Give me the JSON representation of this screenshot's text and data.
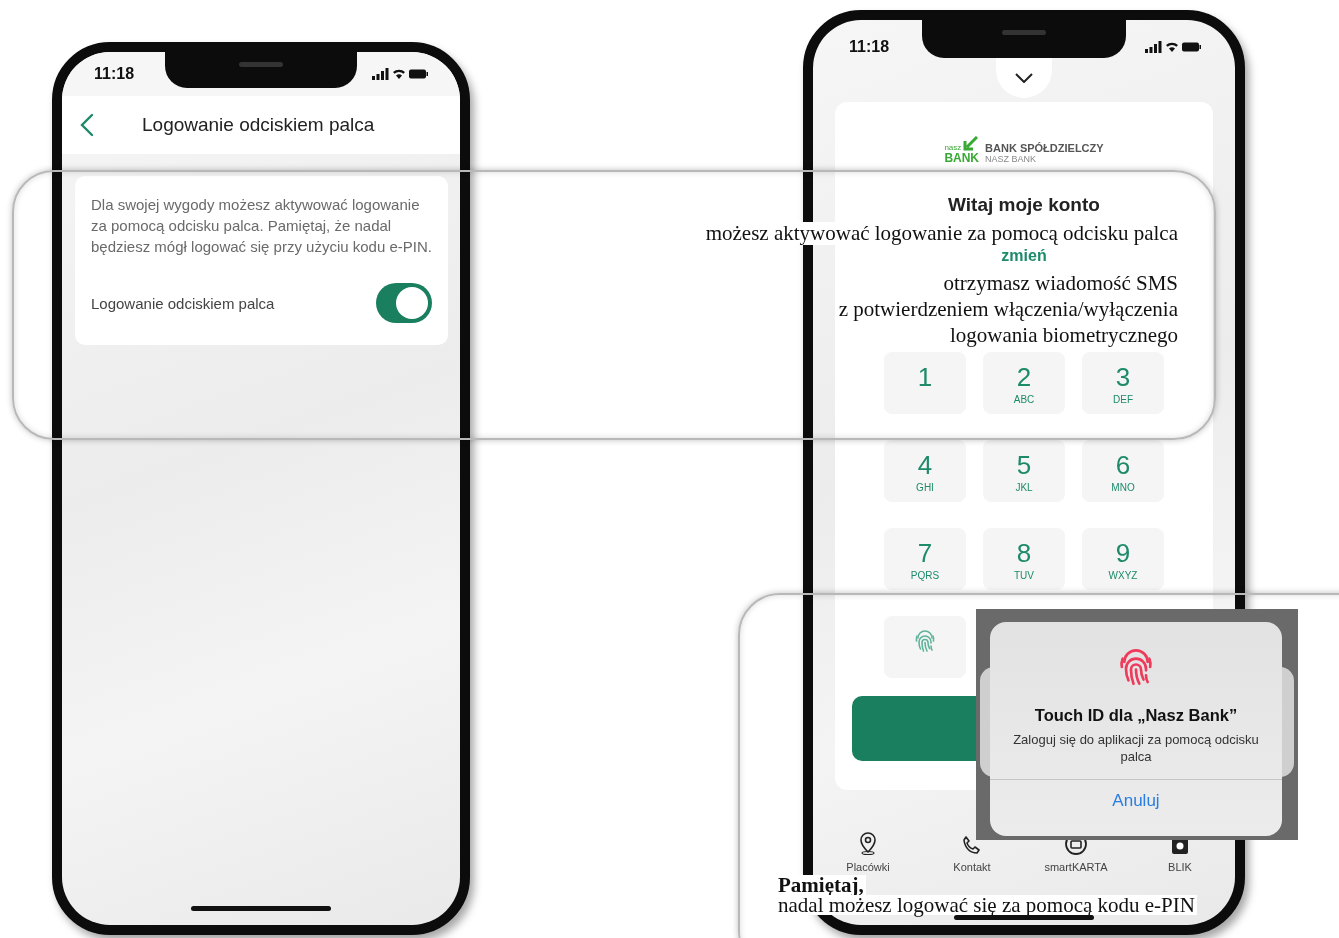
{
  "left_phone": {
    "status_bar": {
      "time": "11:18"
    },
    "header": {
      "title": "Logowanie odciskiem palca"
    },
    "card": {
      "description": "Dla swojej wygody możesz aktywować logowanie za pomocą odcisku palca. Pamiętaj, że nadal będziesz mógł logować się przy użyciu kodu e-PIN.",
      "setting": {
        "label": "Logowanie odciskiem palca",
        "on": true
      }
    }
  },
  "right_phone": {
    "status_bar": {
      "time": "11:18"
    },
    "logo": {
      "mark_top": "nasz",
      "mark_bottom": "BANK",
      "name": "BANK SPÓŁDZIELCZY",
      "subname": "NASZ BANK"
    },
    "greeting": "Witaj moje konto",
    "change_link": "zmień",
    "keypad": [
      {
        "kind": "digit",
        "digit": "1"
      },
      {
        "kind": "digit",
        "digit": "2",
        "letters": "ABC"
      },
      {
        "kind": "digit",
        "digit": "3",
        "letters": "DEF"
      },
      {
        "kind": "digit",
        "digit": "4",
        "letters": "GHI"
      },
      {
        "kind": "digit",
        "digit": "5",
        "letters": "JKL"
      },
      {
        "kind": "digit",
        "digit": "6",
        "letters": "MNO"
      },
      {
        "kind": "digit",
        "digit": "7",
        "letters": "PQRS"
      },
      {
        "kind": "digit",
        "digit": "8",
        "letters": "TUV"
      },
      {
        "kind": "digit",
        "digit": "9",
        "letters": "WXYZ"
      },
      {
        "kind": "biometric"
      }
    ],
    "tab_bar": [
      {
        "label": "Placówki"
      },
      {
        "label": "Kontakt"
      },
      {
        "label": "smartKARTA"
      },
      {
        "label": "BLIK"
      }
    ]
  },
  "touch_id_dialog": {
    "title": "Touch ID dla „Nasz Bank”",
    "message": "Zaloguj się do aplikacji za pomocą odcisku palca",
    "cancel": "Anuluj"
  },
  "callouts": [
    {
      "lines": [
        "możesz aktywować logowanie za pomocą odcisku palca"
      ]
    },
    {
      "lines": [
        "otrzymasz wiadomość SMS",
        "z potwierdzeniem włączenia/wyłączenia",
        "logowania biometrycznego"
      ]
    },
    {
      "heading": "Pamiętaj,",
      "lines": [
        "nadal możesz logować się za pomocą kodu e-PIN"
      ]
    }
  ]
}
